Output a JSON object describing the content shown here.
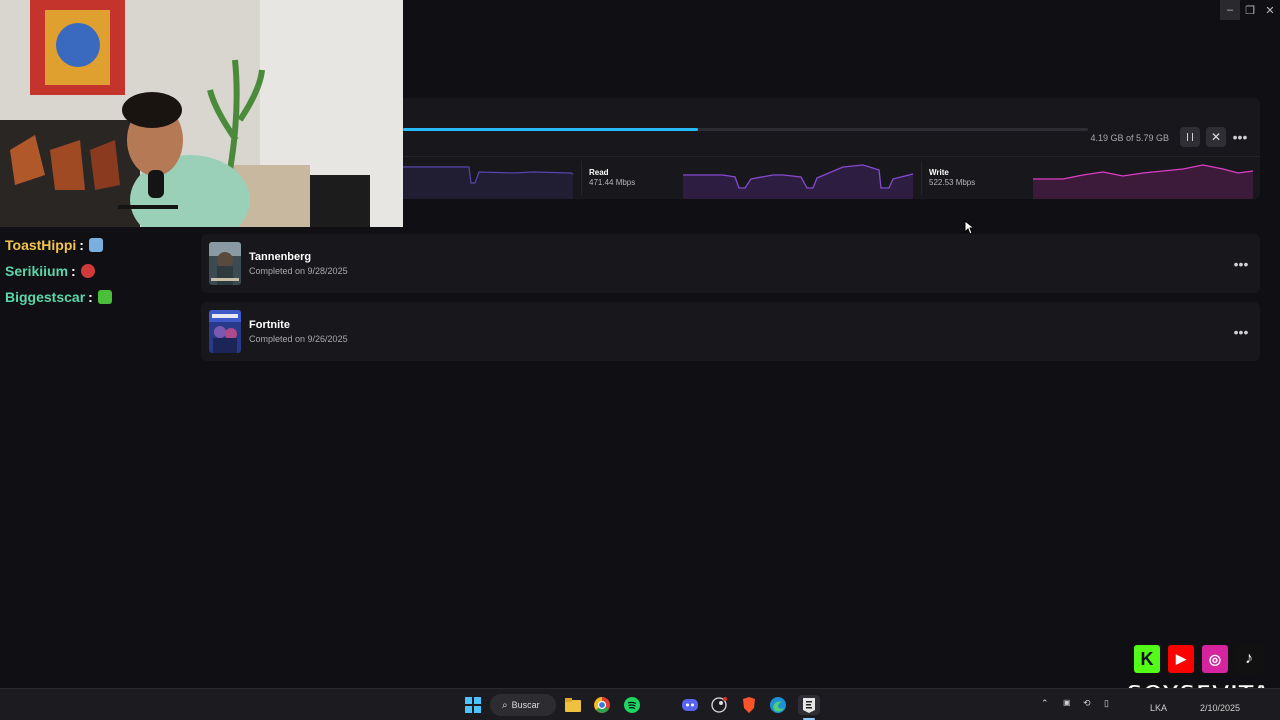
{
  "window": {
    "minimize": "–",
    "restore": "❐",
    "close": "✕"
  },
  "download": {
    "progress_fraction": 0.43,
    "size_text": "4.19 GB of 5.79 GB",
    "pause_icon": "pause-icon",
    "cancel_icon": "close-icon",
    "more_icon": "more-icon",
    "stats": [
      {
        "label": "",
        "value": ""
      },
      {
        "label": "Read",
        "value": "471.44 Mbps"
      },
      {
        "label": "Write",
        "value": "522.53 Mbps"
      }
    ]
  },
  "library": {
    "items": [
      {
        "title": "Tannenberg",
        "status": "Completed on 9/28/2025"
      },
      {
        "title": "Fortnite",
        "status": "Completed on 9/26/2025"
      }
    ]
  },
  "chat": [
    {
      "user": "ToastHippi",
      "colon": ":"
    },
    {
      "user": "Serikiium",
      "colon": ":"
    },
    {
      "user": "Biggestscar",
      "colon": ":"
    }
  ],
  "overlay": {
    "brand": "SOYSEVITA"
  },
  "taskbar": {
    "search_label": "Buscar",
    "lang": "LKA",
    "clock": "2/10/2025"
  },
  "colors": {
    "accent": "#26bbff",
    "read_line": "#7c5cd9",
    "write_line": "#e040c8",
    "chat_user": "#f3c44c"
  }
}
